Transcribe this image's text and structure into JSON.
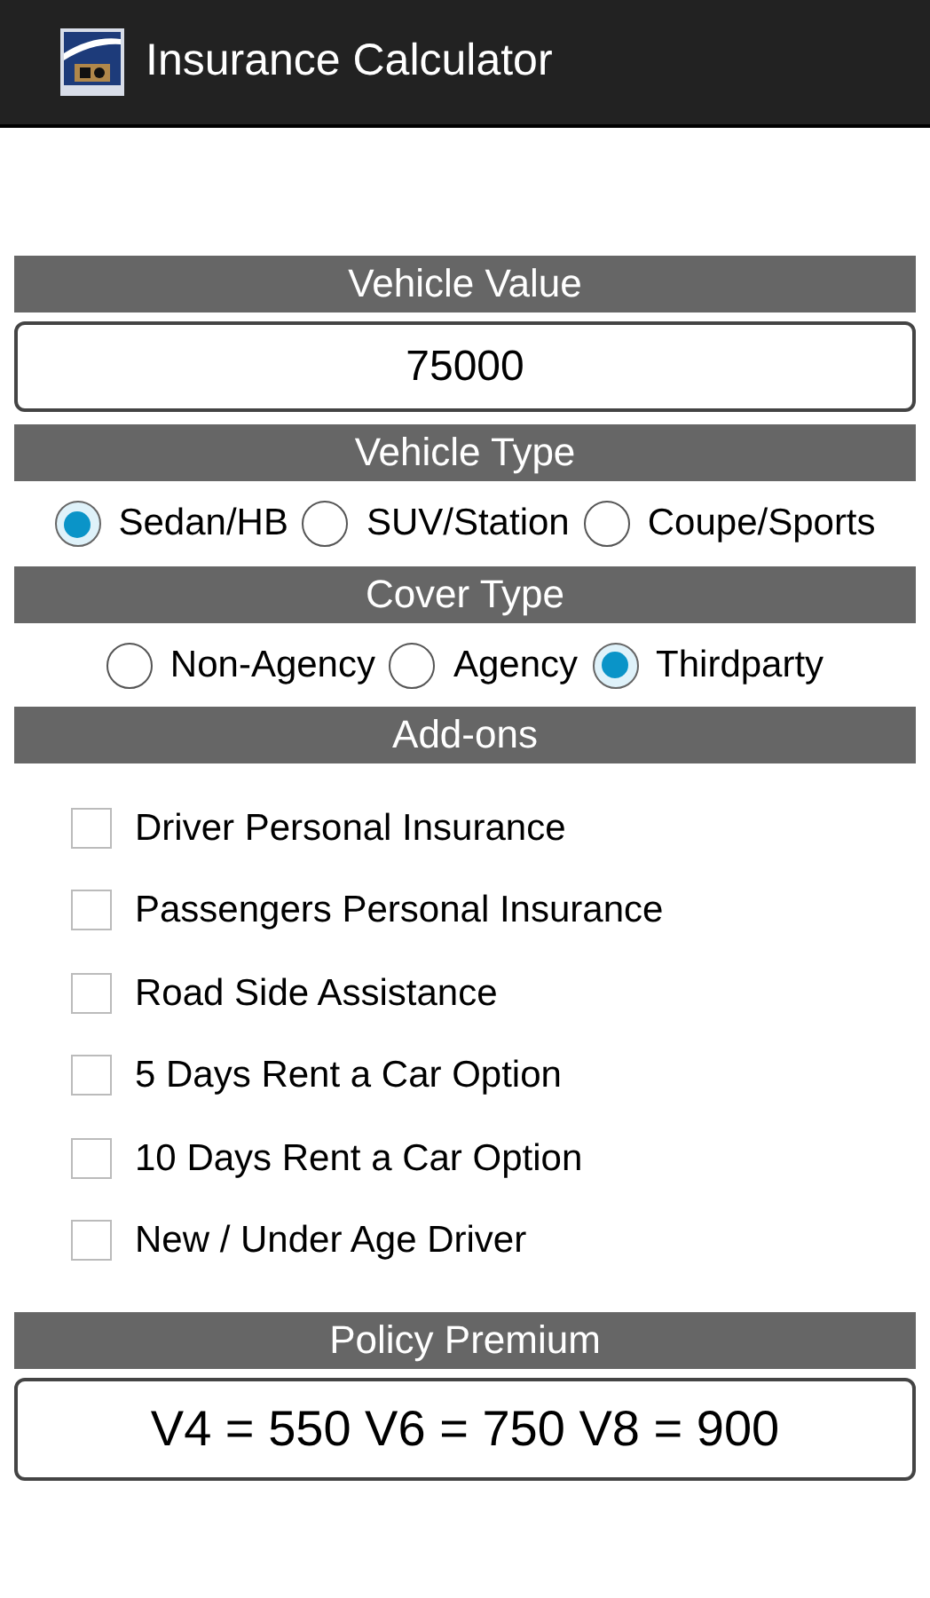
{
  "app_bar": {
    "title": "Insurance Calculator"
  },
  "vehicle_value": {
    "header": "Vehicle Value",
    "value": "75000"
  },
  "vehicle_type": {
    "header": "Vehicle Type",
    "options": [
      {
        "label": "Sedan/HB",
        "selected": true
      },
      {
        "label": "SUV/Station",
        "selected": false
      },
      {
        "label": "Coupe/Sports",
        "selected": false
      }
    ]
  },
  "cover_type": {
    "header": "Cover Type",
    "options": [
      {
        "label": "Non-Agency",
        "selected": false
      },
      {
        "label": "Agency",
        "selected": false
      },
      {
        "label": "Thirdparty",
        "selected": true
      }
    ]
  },
  "addons": {
    "header": "Add-ons",
    "items": [
      {
        "label": "Driver Personal Insurance",
        "checked": false
      },
      {
        "label": "Passengers Personal Insurance",
        "checked": false
      },
      {
        "label": "Road Side Assistance",
        "checked": false
      },
      {
        "label": "5 Days Rent a Car Option",
        "checked": false
      },
      {
        "label": "10 Days Rent a Car Option",
        "checked": false
      },
      {
        "label": "New / Under Age Driver",
        "checked": false
      }
    ]
  },
  "policy_premium": {
    "header": "Policy Premium",
    "value": "V4 = 550 V6 = 750 V8 = 900"
  }
}
